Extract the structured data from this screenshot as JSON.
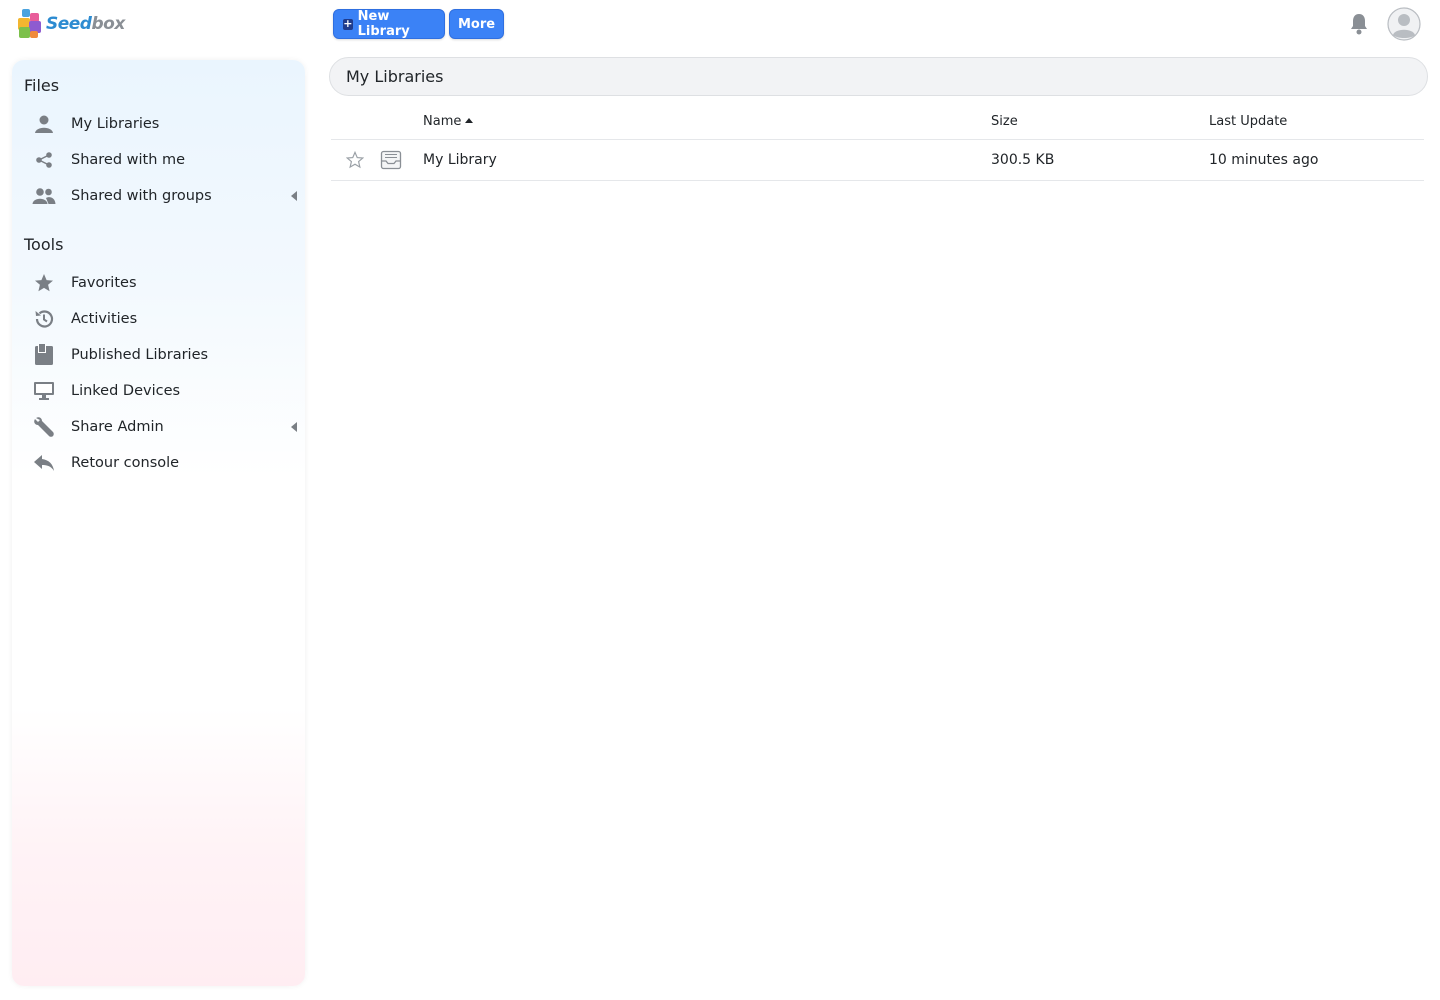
{
  "header": {
    "logo_text_a": "Seed",
    "logo_text_b": "box",
    "new_library_label": "New Library",
    "more_label": "More"
  },
  "sidebar": {
    "files_title": "Files",
    "files_items": [
      {
        "label": "My Libraries",
        "icon": "user-icon"
      },
      {
        "label": "Shared with me",
        "icon": "share-icon"
      },
      {
        "label": "Shared with groups",
        "icon": "group-icon"
      }
    ],
    "tools_title": "Tools",
    "tools_items": [
      {
        "label": "Favorites",
        "icon": "star-icon"
      },
      {
        "label": "Activities",
        "icon": "history-icon"
      },
      {
        "label": "Published Libraries",
        "icon": "wiki-icon"
      },
      {
        "label": "Linked Devices",
        "icon": "monitor-icon"
      },
      {
        "label": "Share Admin",
        "icon": "wrench-icon"
      },
      {
        "label": "Retour console",
        "icon": "reply-icon"
      }
    ]
  },
  "main": {
    "path": "My Libraries",
    "columns": {
      "name": "Name",
      "size": "Size",
      "last_update": "Last Update"
    },
    "rows": [
      {
        "name": "My Library",
        "size": "300.5 KB",
        "last_update": "10 minutes ago"
      }
    ]
  },
  "colors": {
    "accent": "#3b82f6",
    "icon_gray": "#7a7f85"
  }
}
